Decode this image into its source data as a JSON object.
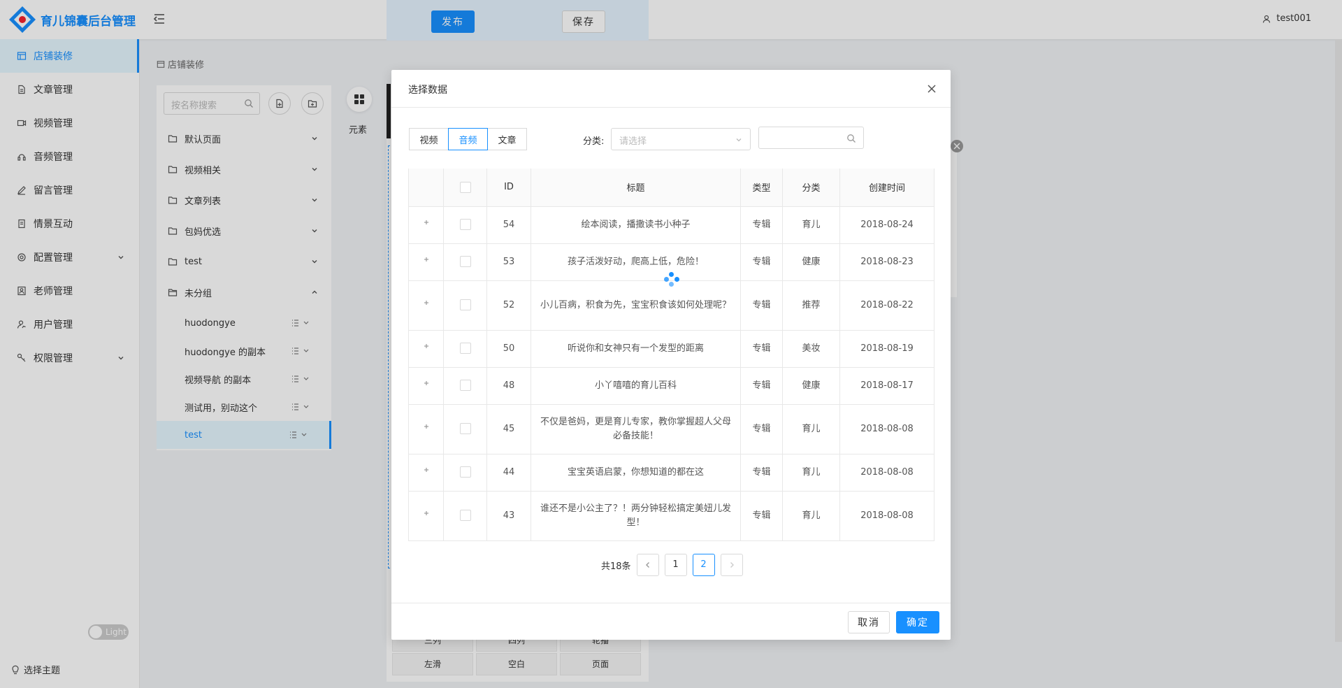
{
  "app": {
    "title": "育儿锦囊后台管理"
  },
  "toolbar": {
    "publish_label": "发布",
    "save_label": "保存"
  },
  "user": {
    "name": "test001"
  },
  "sidebar": {
    "items": [
      {
        "label": "店铺装修",
        "icon": "shop-icon",
        "active": true
      },
      {
        "label": "文章管理",
        "icon": "file-icon"
      },
      {
        "label": "视频管理",
        "icon": "video-icon"
      },
      {
        "label": "音频管理",
        "icon": "audio-icon"
      },
      {
        "label": "留言管理",
        "icon": "edit-icon"
      },
      {
        "label": "情景互动",
        "icon": "book-icon"
      },
      {
        "label": "配置管理",
        "icon": "settings-icon",
        "expandable": true
      },
      {
        "label": "老师管理",
        "icon": "teacher-icon"
      },
      {
        "label": "用户管理",
        "icon": "user-icon"
      },
      {
        "label": "权限管理",
        "icon": "key-icon",
        "expandable": true
      }
    ],
    "theme_label": "选择主题",
    "theme_toggle": "Light"
  },
  "breadcrumb": {
    "label": "店铺装修"
  },
  "tree": {
    "search_placeholder": "按名称搜索",
    "folders": [
      {
        "label": "默认页面"
      },
      {
        "label": "视频相关"
      },
      {
        "label": "文章列表"
      },
      {
        "label": "包妈优选"
      },
      {
        "label": "test"
      },
      {
        "label": "未分组",
        "expanded": true
      }
    ],
    "pages": [
      {
        "label": "huodongye"
      },
      {
        "label": "huodongye 的副本"
      },
      {
        "label": "视频导航 的副本"
      },
      {
        "label": "测试用，别动这个"
      },
      {
        "label": "test",
        "active": true
      }
    ]
  },
  "elements": {
    "label": "元素"
  },
  "canvas": {
    "grid": [
      "三列",
      "四列",
      "轮播",
      "左滑",
      "空白",
      "页面"
    ]
  },
  "modal": {
    "title": "选择数据",
    "tabs": [
      {
        "label": "视频"
      },
      {
        "label": "音频",
        "active": true
      },
      {
        "label": "文章"
      }
    ],
    "category_label": "分类:",
    "category_placeholder": "请选择",
    "search_value": "",
    "columns": [
      "",
      "",
      "ID",
      "标题",
      "类型",
      "分类",
      "创建时间"
    ],
    "rows": [
      {
        "id": "54",
        "title": "绘本阅读，播撒读书小种子",
        "type": "专辑",
        "category": "育儿",
        "created": "2018-08-24"
      },
      {
        "id": "53",
        "title": "孩子活泼好动，爬高上低，危险！",
        "type": "专辑",
        "category": "健康",
        "created": "2018-08-23"
      },
      {
        "id": "52",
        "title": "小儿百病，积食为先，宝宝积食该如何处理呢？",
        "type": "专辑",
        "category": "推荐",
        "created": "2018-08-22"
      },
      {
        "id": "50",
        "title": "听说你和女神只有一个发型的距离",
        "type": "专辑",
        "category": "美妆",
        "created": "2018-08-19"
      },
      {
        "id": "48",
        "title": "小丫嘻嘻的育儿百科",
        "type": "专辑",
        "category": "健康",
        "created": "2018-08-17"
      },
      {
        "id": "45",
        "title": "不仅是爸妈，更是育儿专家，教你掌握超人父母必备技能！",
        "type": "专辑",
        "category": "育儿",
        "created": "2018-08-08"
      },
      {
        "id": "44",
        "title": "宝宝英语启蒙，你想知道的都在这",
        "type": "专辑",
        "category": "育儿",
        "created": "2018-08-08"
      },
      {
        "id": "43",
        "title": "谁还不是小公主了？！两分钟轻松搞定美妞儿发型！",
        "type": "专辑",
        "category": "育儿",
        "created": "2018-08-08"
      }
    ],
    "total_label": "共18条",
    "pages": [
      "1",
      "2"
    ],
    "current_page": "2",
    "cancel_label": "取消",
    "ok_label": "确定"
  },
  "colors": {
    "primary": "#1890ff",
    "sidebar_active_bg": "#e6f7ff"
  }
}
